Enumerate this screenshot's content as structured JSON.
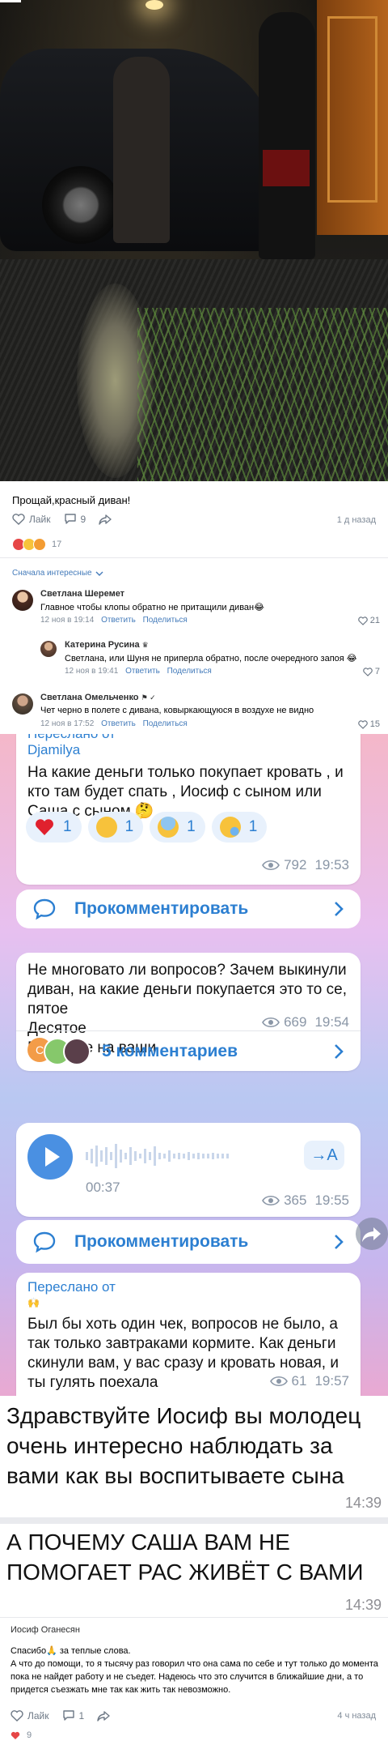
{
  "post": {
    "text": "Прощай,красный диван!",
    "like_label": "Лайк",
    "comment_count": "9",
    "time": "1 д назад",
    "reactions_count": "17"
  },
  "comments": {
    "sort_label": "Сначала интересные",
    "items": [
      {
        "name": "Светлана Шеремет",
        "text": "Главное чтобы клопы обратно не притащили диван😂",
        "date": "12 ноя в 19:14",
        "reply": "Ответить",
        "share": "Поделиться",
        "likes": "21"
      },
      {
        "name": "Катерина Русина",
        "text": "Светлана, или Шуня не приперла обратно, после очередного запоя 😂",
        "date": "12 ноя в 19:41",
        "reply": "Ответить",
        "share": "Поделиться",
        "likes": "7"
      },
      {
        "name": "Светлана Омельченко",
        "text": "Чет черно в полете с дивана, ковыркающуюся в воздухе не видно",
        "date": "12 ноя в 17:52",
        "reply": "Ответить",
        "share": "Поделиться",
        "likes": "15"
      }
    ],
    "reply_mention": "Светлана,"
  },
  "chat": {
    "msg1": {
      "forwarded_label": "Переслано от",
      "from": "Djamilya",
      "text": "На какие деньги только покупает кровать , и кто там будет спать , Иосиф с сыном или Саша с сыном 🤔",
      "reactions": [
        {
          "emoji": "heart-emoji",
          "count": "1"
        },
        {
          "emoji": "thinking-emoji",
          "count": "1"
        },
        {
          "emoji": "scream-emoji",
          "count": "1"
        },
        {
          "emoji": "crying-emoji",
          "count": "1"
        }
      ],
      "views": "792",
      "time": "19:53"
    },
    "comment_btn1": "Прокомментировать",
    "msg2": {
      "text": "Не многовато ли вопросов? Зачем выкинули диван, на какие деньги покупается это то се, пятое\nДесятое\nРебят, не на ваши",
      "views": "669",
      "time": "19:54",
      "comments_label": "5 комментариев"
    },
    "msg3": {
      "duration": "00:37",
      "transcribe": "→A",
      "views": "365",
      "time": "19:55"
    },
    "comment_btn2": "Прокомментировать",
    "msg4": {
      "forwarded_label": "Переслано от",
      "text": "Был бы хоть один чек, вопросов не было, а так только завтраками кормите. Как деньги скинули вам, у вас сразу и кровать новая, и ты гулять поехала",
      "views": "61",
      "time": "19:57"
    },
    "accent": "#2c7fd1"
  },
  "text1": {
    "text": "Здравствуйте Иосиф вы молодец очень интересно наблюдать за вами как вы воспитываете сына",
    "time": "14:39"
  },
  "text2": {
    "text": "А ПОЧЕМУ САША ВАМ НЕ ПОМОГАЕТ  РАС ЖИВЁТ С ВАМИ",
    "time": "14:39"
  },
  "reply_post": {
    "author": "Иосиф Оганесян",
    "text": "Спасибо🙏 за теплые слова.\nА что до помощи, то я тысячу раз говорил что она сама по себе и тут только до момента пока не найдет работу и не съедет. Надеюсь что это случится в ближайшие дни, а то придется съезжать мне так как жить так невозможно.",
    "like_label": "Лайк",
    "comment_count": "1",
    "time": "4 ч назад",
    "reactions_count": "9"
  }
}
